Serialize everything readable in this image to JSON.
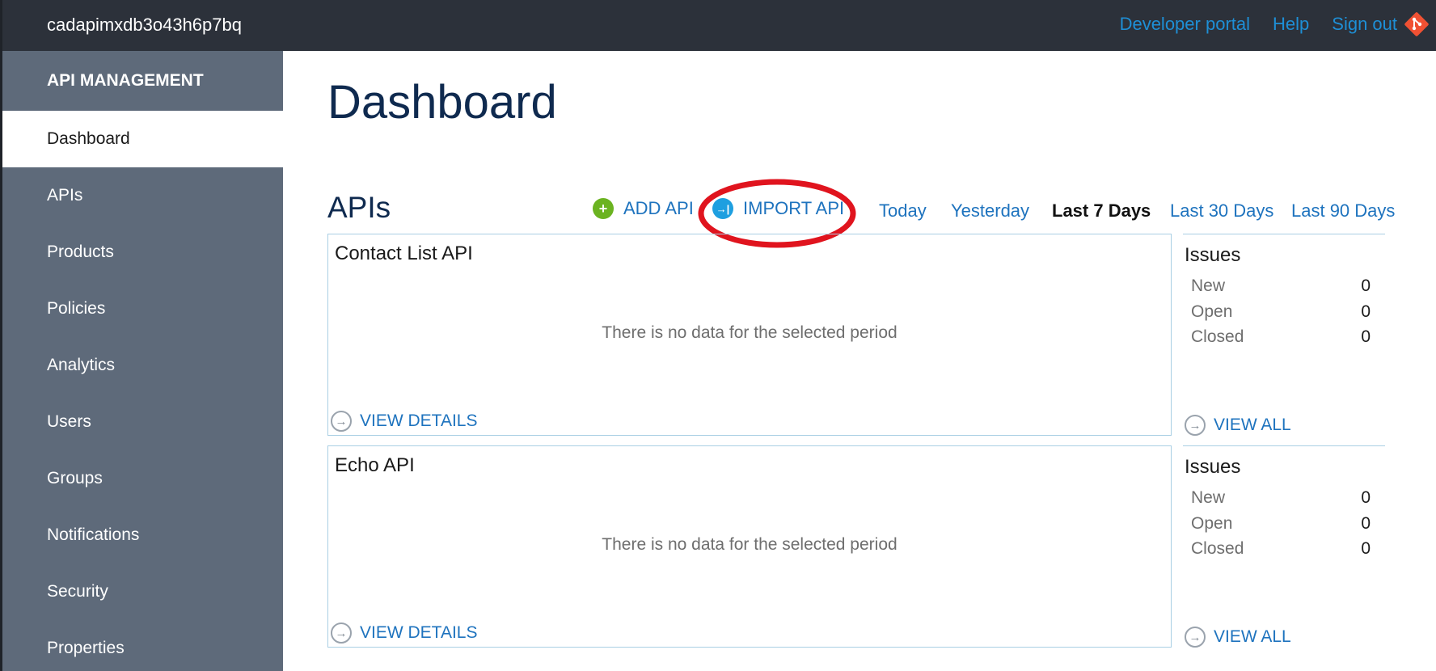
{
  "header": {
    "instance_name": "cadapimxdb3o43h6p7bq",
    "links": [
      "Developer portal",
      "Help",
      "Sign out"
    ]
  },
  "sidebar": {
    "title": "API MANAGEMENT",
    "items": [
      {
        "label": "Dashboard",
        "active": true
      },
      {
        "label": "APIs"
      },
      {
        "label": "Products"
      },
      {
        "label": "Policies"
      },
      {
        "label": "Analytics"
      },
      {
        "label": "Users"
      },
      {
        "label": "Groups"
      },
      {
        "label": "Notifications"
      },
      {
        "label": "Security"
      },
      {
        "label": "Properties"
      }
    ]
  },
  "main": {
    "page_title": "Dashboard",
    "section_title": "APIs",
    "actions": {
      "add_api": "ADD API",
      "import_api": "IMPORT API"
    },
    "periods": [
      "Today",
      "Yesterday",
      "Last 7 Days",
      "Last 30 Days",
      "Last 90 Days"
    ],
    "active_period": "Last 7 Days",
    "apis": [
      {
        "name": "Contact List API",
        "no_data": "There is no data for the selected period",
        "view_details": "VIEW DETAILS",
        "issues": {
          "title": "Issues",
          "new_label": "New",
          "new": "0",
          "open_label": "Open",
          "open": "0",
          "closed_label": "Closed",
          "closed": "0",
          "view_all": "VIEW ALL"
        }
      },
      {
        "name": "Echo API",
        "no_data": "There is no data for the selected period",
        "view_details": "VIEW DETAILS",
        "issues": {
          "title": "Issues",
          "new_label": "New",
          "new": "0",
          "open_label": "Open",
          "open": "0",
          "closed_label": "Closed",
          "closed": "0",
          "view_all": "VIEW ALL"
        }
      }
    ]
  },
  "colors": {
    "topbar": "#2c313a",
    "sidebar": "#5e6a7a",
    "link": "#1e73be",
    "title": "#0f2a4f",
    "highlight": "#e0141e"
  }
}
